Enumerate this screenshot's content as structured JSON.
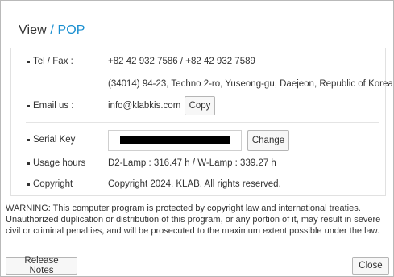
{
  "window": {
    "title": "View",
    "title_separator": " / ",
    "title_sub": "POP"
  },
  "info": {
    "tel_label": "Tel / Fax :",
    "tel_value": "+82 42 932 7586 / +82 42 932 7589",
    "address_value": "(34014) 94-23, Techno 2-ro, Yuseong-gu, Daejeon, Republic of Korea",
    "email_label": "Email us :",
    "email_value": "info@klabkis.com",
    "copy_label": "Copy",
    "serial_label": "Serial Key",
    "serial_value": "",
    "change_label": "Change",
    "usage_label": "Usage hours",
    "usage_value": "D2-Lamp : 316.47 h / W-Lamp : 339.27 h",
    "copyright_label": "Copyright",
    "copyright_value": "Copyright 2024. KLAB. All rights reserved."
  },
  "warning": "WARNING: This computer program is protected by copyright law and international treaties. Unauthorized duplication or distribution of this program, or any portion of it, may result in severe civil or criminal penalties, and will be prosecuted to the maximum extent possible under the law.",
  "footer": {
    "release_notes_label": "Release Notes",
    "close_label": "Close"
  },
  "colors": {
    "accent": "#1a8fd0",
    "border": "#b9b9b9",
    "button_bg": "#f7f7f7"
  }
}
